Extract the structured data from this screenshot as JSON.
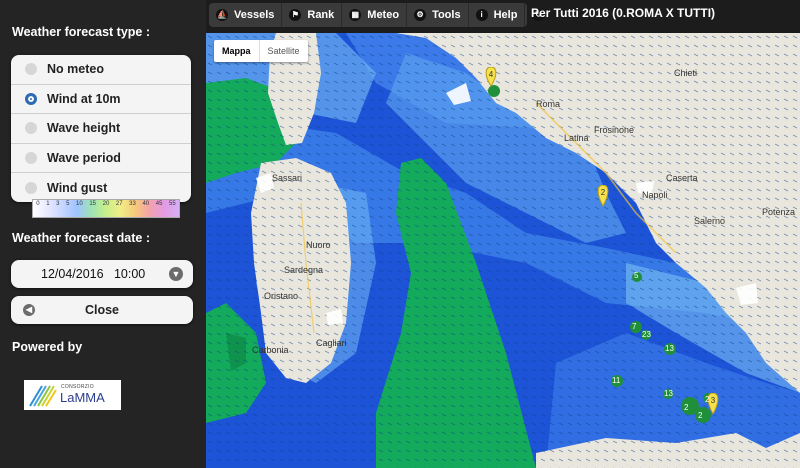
{
  "sidebar": {
    "forecast_type_title": "Weather forecast type :",
    "options": [
      {
        "label": "No meteo",
        "selected": false
      },
      {
        "label": "Wind at 10m",
        "selected": true
      },
      {
        "label": "Wave height",
        "selected": false
      },
      {
        "label": "Wave period",
        "selected": false
      },
      {
        "label": "Wind gust",
        "selected": false
      }
    ],
    "legend_numbers": [
      "0",
      "1",
      "3",
      "5",
      "10",
      "15",
      "20",
      "27",
      "33",
      "40",
      "45",
      "55"
    ],
    "forecast_date_title": "Weather forecast date :",
    "forecast_date_value": "12/04/2016   10:00",
    "close_label": "Close",
    "powered_by": "Powered by",
    "logo_small": "CONSORZIO",
    "logo_big": "LaMMA"
  },
  "toolbar": {
    "items": [
      {
        "label": "Vessels",
        "icon": "sailboat-icon"
      },
      {
        "label": "Rank",
        "icon": "trophy-icon"
      },
      {
        "label": "Meteo",
        "icon": "grid-icon"
      },
      {
        "label": "Tools",
        "icon": "gear-icon"
      },
      {
        "label": "Help",
        "icon": "info-icon"
      },
      {
        "label": "",
        "icon": "refresh-icon"
      }
    ],
    "race_title": "Per Tutti 2016 (0.ROMA X TUTTI)"
  },
  "map": {
    "maptype_selected": "Mappa",
    "maptype_other": "Satellite",
    "cities": [
      "Roma",
      "Napoli",
      "Latina",
      "Frosinone",
      "Sassari",
      "Nuoro",
      "Cagliari",
      "Salerno",
      "Carbonia",
      "Sardegna",
      "Chieti",
      "Caserta",
      "Oristano",
      "Potenza"
    ],
    "markers": [
      "4",
      "2",
      "3"
    ],
    "vessel_badges": [
      "5",
      "7",
      "23",
      "13",
      "11",
      "13",
      "2",
      "2",
      "2"
    ]
  }
}
